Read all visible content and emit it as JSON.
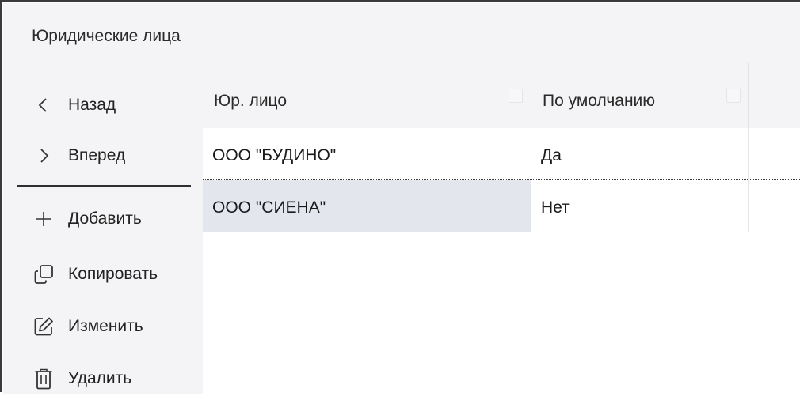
{
  "window": {
    "title": "Юридические лица"
  },
  "sidebar": {
    "items": [
      {
        "label": "Назад",
        "icon": "chevron-left-icon"
      },
      {
        "label": "Вперед",
        "icon": "chevron-right-icon"
      },
      {
        "label": "Добавить",
        "icon": "plus-icon"
      },
      {
        "label": "Копировать",
        "icon": "copy-icon"
      },
      {
        "label": "Изменить",
        "icon": "edit-icon"
      },
      {
        "label": "Удалить",
        "icon": "trash-icon"
      }
    ]
  },
  "grid": {
    "columns": [
      {
        "label": "Юр. лицо"
      },
      {
        "label": "По умолчанию"
      }
    ],
    "rows": [
      {
        "entity": "ООО \"БУДИНО\"",
        "default": "Да"
      },
      {
        "entity": "ООО \"СИЕНА\"",
        "default": "Нет"
      }
    ]
  },
  "colors": {
    "panel": "#f4f4f6",
    "selected_cell": "#e4e6ee"
  }
}
